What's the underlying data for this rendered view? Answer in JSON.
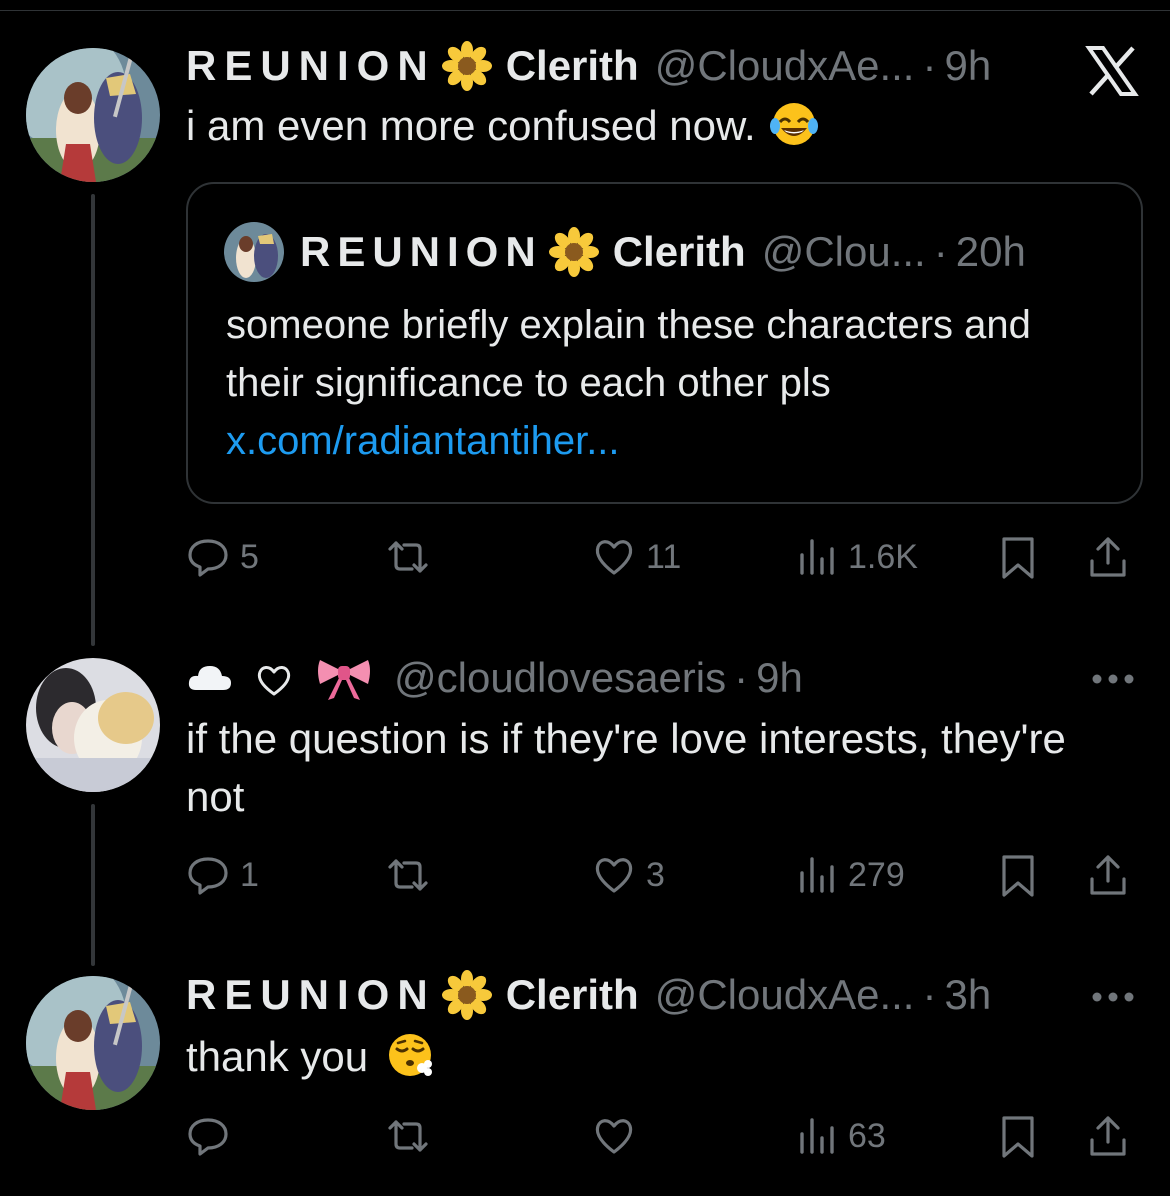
{
  "posts": [
    {
      "display_name": "REUNION",
      "display_name_suffix": "Clerith",
      "handle": "@CloudxAe...",
      "time": "9h",
      "text": "i am even more confused now.",
      "quote": {
        "display_name": "REUNION",
        "display_name_suffix": "Clerith",
        "handle": "@Clou...",
        "time": "20h",
        "text": "someone briefly explain these characters and their significance to each other pls",
        "link": "x.com/radiantantiher..."
      },
      "actions": {
        "replies": "5",
        "reposts": "",
        "likes": "11",
        "views": "1.6K"
      }
    },
    {
      "display_name": "",
      "handle": "@cloudlovesaeris",
      "time": "9h",
      "text": "if the question is if they're love interests, they're not",
      "actions": {
        "replies": "1",
        "reposts": "",
        "likes": "3",
        "views": "279"
      }
    },
    {
      "display_name": "REUNION",
      "display_name_suffix": "Clerith",
      "handle": "@CloudxAe...",
      "time": "3h",
      "text": "thank you",
      "actions": {
        "replies": "",
        "reposts": "",
        "likes": "",
        "views": "63"
      }
    }
  ],
  "separator": "·",
  "icons": {
    "platform_logo": "x-logo-icon",
    "name_flower": "sunflower-emoji",
    "post1_emoji": "face-with-tears-of-joy-emoji",
    "post3_emoji": "face-exhaling-emoji",
    "post2_name_icons": [
      "cloud-emoji",
      "heart-outline-icon",
      "ribbon-emoji"
    ]
  },
  "colors": {
    "background": "#000000",
    "text": "#e7e9ea",
    "muted": "#71767b",
    "link": "#1d9bf0",
    "border": "#2f3336"
  }
}
